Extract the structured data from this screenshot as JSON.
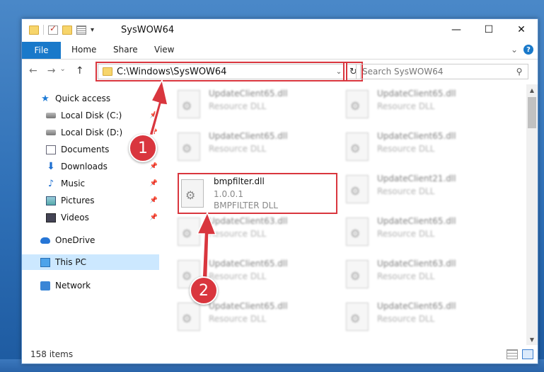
{
  "window": {
    "title": "SysWOW64",
    "controls": {
      "minimize": "—",
      "maximize": "☐",
      "close": "✕"
    }
  },
  "ribbon": {
    "tabs": [
      "File",
      "Home",
      "Share",
      "View"
    ],
    "expand_glyph": "⌄",
    "help_glyph": "?"
  },
  "address_bar": {
    "path": "C:\\Windows\\SysWOW64",
    "dropdown_glyph": "⌄",
    "refresh_glyph": "↻"
  },
  "search": {
    "placeholder": "Search SysWOW64",
    "icon": "search-icon"
  },
  "nav_buttons": {
    "back": "←",
    "forward": "→",
    "recent": "⌄",
    "up": "↑"
  },
  "nav_pane": {
    "items": [
      {
        "label": "Quick access",
        "icon": "star-icon"
      },
      {
        "label": "Local Disk (C:)",
        "icon": "drive-icon",
        "pinned": true
      },
      {
        "label": "Local Disk (D:)",
        "icon": "drive-icon",
        "pinned": true
      },
      {
        "label": "Documents",
        "icon": "documents-icon",
        "pinned": true
      },
      {
        "label": "Downloads",
        "icon": "downloads-icon",
        "pinned": true
      },
      {
        "label": "Music",
        "icon": "music-icon",
        "pinned": true
      },
      {
        "label": "Pictures",
        "icon": "pictures-icon",
        "pinned": true
      },
      {
        "label": "Videos",
        "icon": "videos-icon",
        "pinned": true
      },
      {
        "label": "OneDrive",
        "icon": "onedrive-icon"
      },
      {
        "label": "This PC",
        "icon": "this-pc-icon",
        "selected": true
      },
      {
        "label": "Network",
        "icon": "network-icon"
      }
    ]
  },
  "files": {
    "left_column": [
      {
        "name": "UpdateClient65.dll",
        "type": "Resource DLL"
      },
      {
        "name": "UpdateClient65.dll",
        "type": "Resource DLL"
      },
      {
        "name": "UpdateClient63.dll",
        "type": "Resource DLL"
      },
      {
        "name": "UpdateClient65.dll",
        "type": "Resource DLL"
      },
      {
        "name": "UpdateClient65.dll",
        "type": "Resource DLL"
      }
    ],
    "right_column": [
      {
        "name": "UpdateClient65.dll",
        "type": "Resource DLL"
      },
      {
        "name": "UpdateClient65.dll",
        "type": "Resource DLL"
      },
      {
        "name": "UpdateClient21.dll",
        "type": "Resource DLL"
      },
      {
        "name": "UpdateClient65.dll",
        "type": "Resource DLL"
      },
      {
        "name": "UpdateClient63.dll",
        "type": "Resource DLL"
      },
      {
        "name": "UpdateClient65.dll",
        "type": "Resource DLL"
      }
    ],
    "highlighted": {
      "name": "bmpfilter.dll",
      "version": "1.0.0.1",
      "type": "BMPFILTER DLL"
    }
  },
  "status": {
    "item_count": "158 items"
  },
  "callouts": {
    "one": "1",
    "two": "2",
    "color": "#d9363e"
  }
}
